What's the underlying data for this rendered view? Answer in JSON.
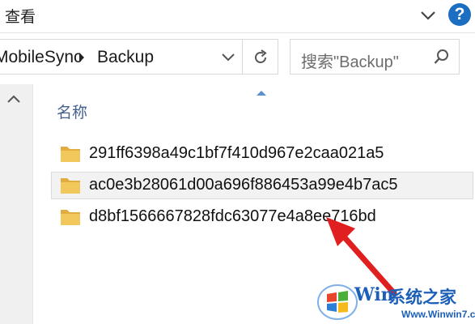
{
  "ribbon": {
    "tab_label": "查看",
    "help_label": "?"
  },
  "address": {
    "crumbs": [
      "MobileSync",
      "Backup"
    ],
    "crumb_separator": "▶"
  },
  "search": {
    "placeholder": "搜索\"Backup\""
  },
  "content": {
    "column_header": "名称",
    "files": [
      {
        "name": "291ff6398a49c1bf7f410d967e2caa021a5",
        "selected": false
      },
      {
        "name": "ac0e3b28061d00a696f886453a99e4b7ac5",
        "selected": true
      },
      {
        "name": "d8bf1566667828fdc63077e4a8ee716bd",
        "selected": false
      }
    ]
  },
  "watermark": {
    "brand_w": "Win",
    "brand_text": "系统之家",
    "site": "Www.Winwin7.com"
  },
  "colors": {
    "folder": "#e8b84a",
    "help_button": "#1b6ec2",
    "annotation_arrow": "#e02020",
    "watermark": "#1c5fb8"
  }
}
